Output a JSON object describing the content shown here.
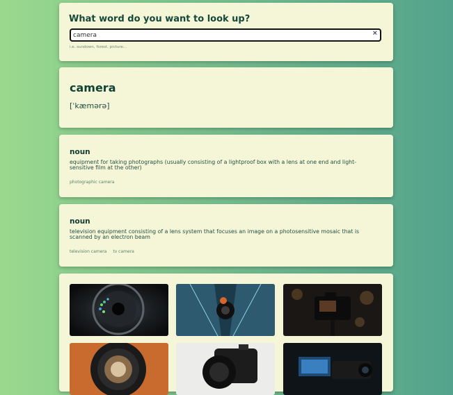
{
  "search": {
    "title": "What word do you want to look up?",
    "value": "camera",
    "hint": "i.e. sundown, forest, picture...",
    "clear_icon": "×"
  },
  "word": {
    "text": "camera",
    "phonetic": "[ˈkæmərə]"
  },
  "meanings": [
    {
      "part_of_speech": "noun",
      "definition": "equipment for taking photographs (usually consisting of a lightproof box with a lens at one end and light-sensitive film at the other)",
      "synonyms": [
        "photographic camera"
      ]
    },
    {
      "part_of_speech": "noun",
      "definition": "television equipment consisting of a lens system that focuses an image on a photosensitive mosaic that is scanned by an electron beam",
      "synonyms": [
        "television camera",
        "tv camera"
      ]
    }
  ],
  "photos": [
    {
      "subject": "camera-lens-aperture-closeup"
    },
    {
      "subject": "camera-on-escalator"
    },
    {
      "subject": "camera-on-tripod-night"
    },
    {
      "subject": "camera-lens-front-view"
    },
    {
      "subject": "dslr-camera-white-background"
    },
    {
      "subject": "video-camera-screen"
    }
  ]
}
